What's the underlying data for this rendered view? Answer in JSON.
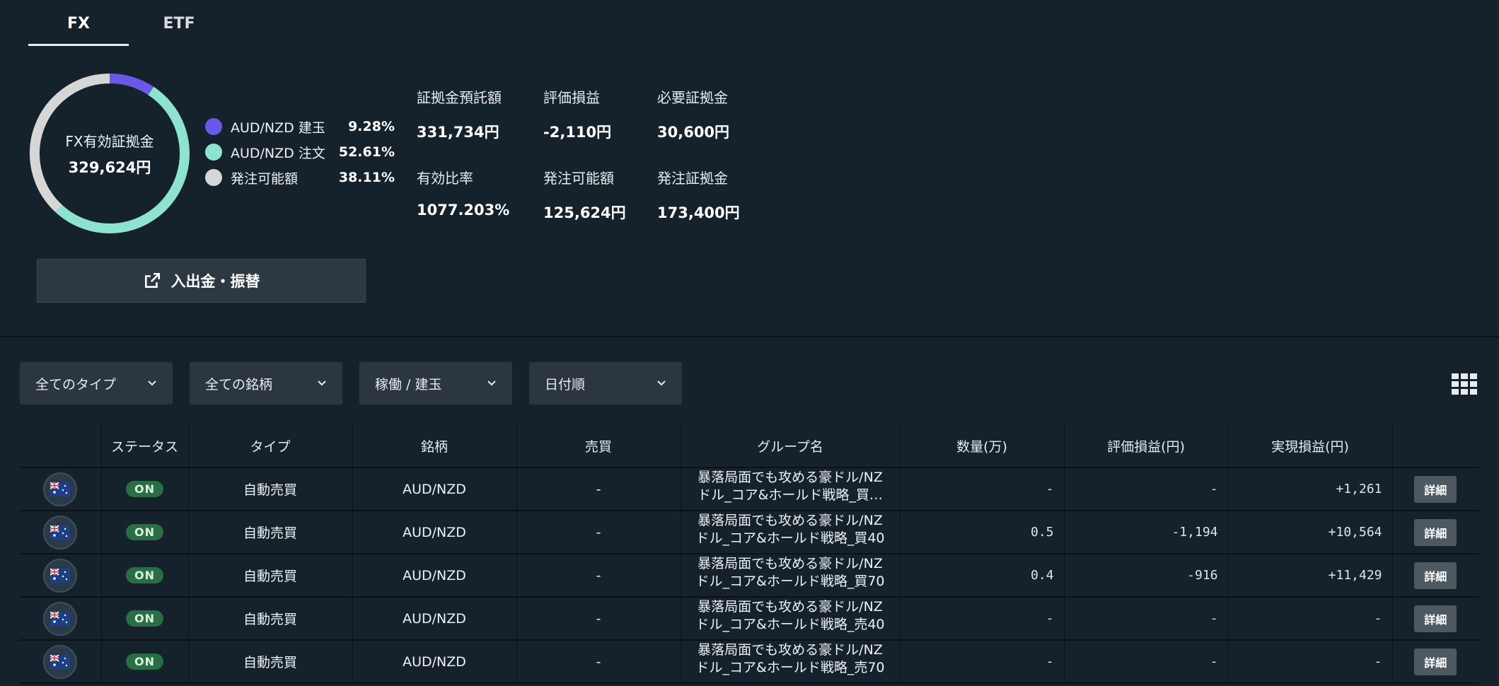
{
  "tabs": [
    {
      "label": "FX",
      "active": true
    },
    {
      "label": "ETF",
      "active": false
    }
  ],
  "donut": {
    "center_label": "FX有効証拠金",
    "center_value": "329,624円",
    "segments": [
      {
        "name": "AUD/NZD 建玉",
        "pct_label": "9.28%",
        "value": 9.28,
        "color": "#6a58e8"
      },
      {
        "name": "AUD/NZD 注文",
        "pct_label": "52.61%",
        "value": 52.61,
        "color": "#8ee3cf"
      },
      {
        "name": "発注可能額",
        "pct_label": "38.11%",
        "value": 38.11,
        "color": "#d6d6d6"
      }
    ]
  },
  "stats": [
    {
      "label": "証拠金預託額",
      "value": "331,734円"
    },
    {
      "label": "評価損益",
      "value": "-2,110円"
    },
    {
      "label": "必要証拠金",
      "value": "30,600円"
    },
    {
      "label": "有効比率",
      "value": "1077.203%"
    },
    {
      "label": "発注可能額",
      "value": "125,624円"
    },
    {
      "label": "発注証拠金",
      "value": "173,400円"
    }
  ],
  "transfer_button": {
    "label": "入出金・振替",
    "icon": "external-link-icon"
  },
  "filters": [
    {
      "value": "全てのタイプ"
    },
    {
      "value": "全ての銘柄"
    },
    {
      "value": "稼働 / 建玉"
    },
    {
      "value": "日付順"
    }
  ],
  "view_toggle_icon": "grid-view-icon",
  "table": {
    "headers": [
      "",
      "ステータス",
      "タイプ",
      "銘柄",
      "売買",
      "グループ名",
      "数量(万)",
      "評価損益(円)",
      "実現損益(円)",
      ""
    ],
    "rows": [
      {
        "icon": "au-flag-icon",
        "status": "ON",
        "type": "自動売買",
        "symbol": "AUD/NZD",
        "side": "-",
        "group_line1": "暴落局面でも攻める豪ドル/NZ",
        "group_line2": "ドル_コア&ホールド戦略_買…",
        "qty": "-",
        "unrealized": "-",
        "realized": "+1,261",
        "action": "詳細"
      },
      {
        "icon": "au-flag-icon",
        "status": "ON",
        "type": "自動売買",
        "symbol": "AUD/NZD",
        "side": "-",
        "group_line1": "暴落局面でも攻める豪ドル/NZ",
        "group_line2": "ドル_コア&ホールド戦略_買40",
        "qty": "0.5",
        "unrealized": "-1,194",
        "realized": "+10,564",
        "action": "詳細"
      },
      {
        "icon": "au-flag-icon",
        "status": "ON",
        "type": "自動売買",
        "symbol": "AUD/NZD",
        "side": "-",
        "group_line1": "暴落局面でも攻める豪ドル/NZ",
        "group_line2": "ドル_コア&ホールド戦略_買70",
        "qty": "0.4",
        "unrealized": "-916",
        "realized": "+11,429",
        "action": "詳細"
      },
      {
        "icon": "au-flag-icon",
        "status": "ON",
        "type": "自動売買",
        "symbol": "AUD/NZD",
        "side": "-",
        "group_line1": "暴落局面でも攻める豪ドル/NZ",
        "group_line2": "ドル_コア&ホールド戦略_売40",
        "qty": "-",
        "unrealized": "-",
        "realized": "-",
        "action": "詳細"
      },
      {
        "icon": "au-flag-icon",
        "status": "ON",
        "type": "自動売買",
        "symbol": "AUD/NZD",
        "side": "-",
        "group_line1": "暴落局面でも攻める豪ドル/NZ",
        "group_line2": "ドル_コア&ホールド戦略_売70",
        "qty": "-",
        "unrealized": "-",
        "realized": "-",
        "action": "詳細"
      }
    ]
  }
}
